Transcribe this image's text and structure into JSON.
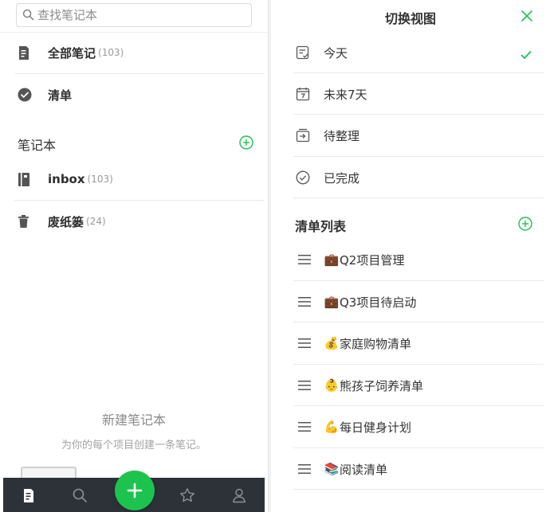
{
  "search": {
    "placeholder": "查找笔记本"
  },
  "nav": [
    {
      "label": "全部笔记",
      "count": "(103)",
      "icon": "note-icon"
    },
    {
      "label": "清单",
      "icon": "checklist-icon"
    }
  ],
  "notebooks": {
    "header": "笔记本",
    "items": [
      {
        "label": "inbox",
        "count": "(103)",
        "icon": "notebook-icon"
      },
      {
        "label": "废纸篓",
        "count": "(24)",
        "icon": "trash-icon"
      }
    ]
  },
  "empty_state": {
    "title": "新建笔记本",
    "description": "为你的每个项目创建一条笔记。"
  },
  "tabbar": {
    "tabs": [
      "notes-tab",
      "search-tab",
      "favorites-tab",
      "profile-tab"
    ],
    "fab_icon": "plus-icon"
  },
  "view_switcher": {
    "title": "切换视图",
    "views": [
      {
        "label": "今天",
        "icon": "today-icon",
        "selected": true
      },
      {
        "label": "未来7天",
        "icon": "calendar-7-icon"
      },
      {
        "label": "待整理",
        "icon": "inbox-tray-icon"
      },
      {
        "label": "已完成",
        "icon": "done-circle-icon"
      }
    ]
  },
  "checklists": {
    "header": "清单列表",
    "items": [
      {
        "emoji": "💼",
        "label": "Q2项目管理"
      },
      {
        "emoji": "💼",
        "label": "Q3项目待启动"
      },
      {
        "emoji": "💰",
        "label": "家庭购物清单"
      },
      {
        "emoji": "👶",
        "label": "熊孩子饲养清单"
      },
      {
        "emoji": "💪",
        "label": "每日健身计划"
      },
      {
        "emoji": "📚",
        "label": "阅读清单"
      }
    ]
  },
  "colors": {
    "accent": "#1dc34f",
    "tabbar": "#2d3239",
    "text": "#333333",
    "muted": "#9a9a9a"
  }
}
